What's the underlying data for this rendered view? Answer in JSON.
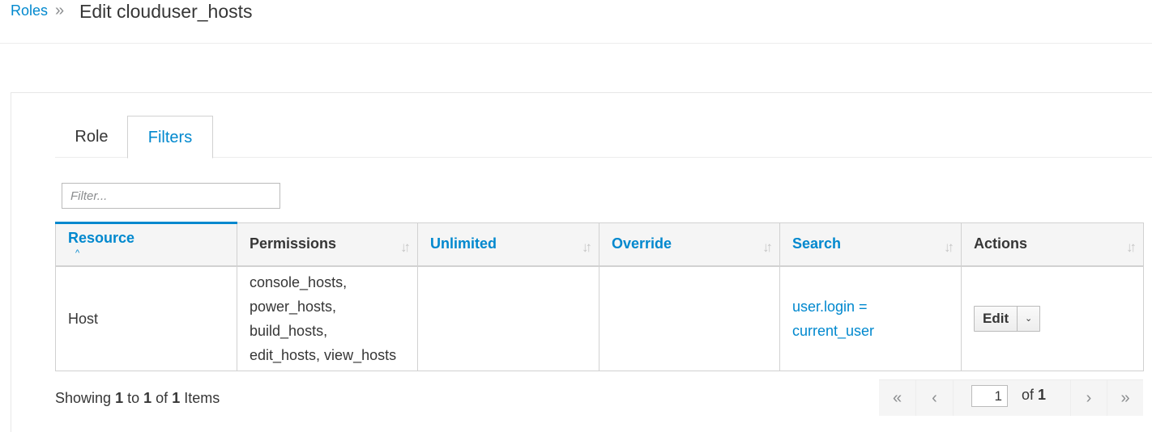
{
  "breadcrumb": {
    "parent": "Roles",
    "separator": "»",
    "current": "Edit clouduser_hosts"
  },
  "tabs": [
    {
      "label": "Role",
      "active": false
    },
    {
      "label": "Filters",
      "active": true
    }
  ],
  "filter": {
    "placeholder": "Filter...",
    "value": ""
  },
  "table": {
    "columns": [
      {
        "label": "Resource",
        "sortable": true,
        "sorted": "asc"
      },
      {
        "label": "Permissions",
        "sortable": false
      },
      {
        "label": "Unlimited",
        "sortable": true
      },
      {
        "label": "Override",
        "sortable": true
      },
      {
        "label": "Search",
        "sortable": true
      },
      {
        "label": "Actions",
        "sortable": false
      }
    ],
    "rows": [
      {
        "resource": "Host",
        "permissions": [
          "console_hosts,",
          "power_hosts,",
          "build_hosts,",
          "edit_hosts, view_hosts"
        ],
        "unlimited": "",
        "override": "",
        "search": [
          "user.login =",
          "current_user"
        ],
        "action_label": "Edit"
      }
    ]
  },
  "summary": {
    "prefix": "Showing",
    "from": "1",
    "to_word": "to",
    "to": "1",
    "of_word": "of",
    "total": "1",
    "suffix": "Items"
  },
  "pagination": {
    "first": "«",
    "prev": "‹",
    "next": "›",
    "last": "»",
    "page": "1",
    "of_word": "of",
    "pages": "1"
  },
  "colors": {
    "link": "#0088ce",
    "text": "#363636",
    "border": "#d1d1d1",
    "header_bg": "#f5f5f5"
  },
  "icons": {
    "sort": "sort-icon",
    "sort_asc": "caret-up-icon",
    "dropdown": "chevron-down-icon"
  }
}
